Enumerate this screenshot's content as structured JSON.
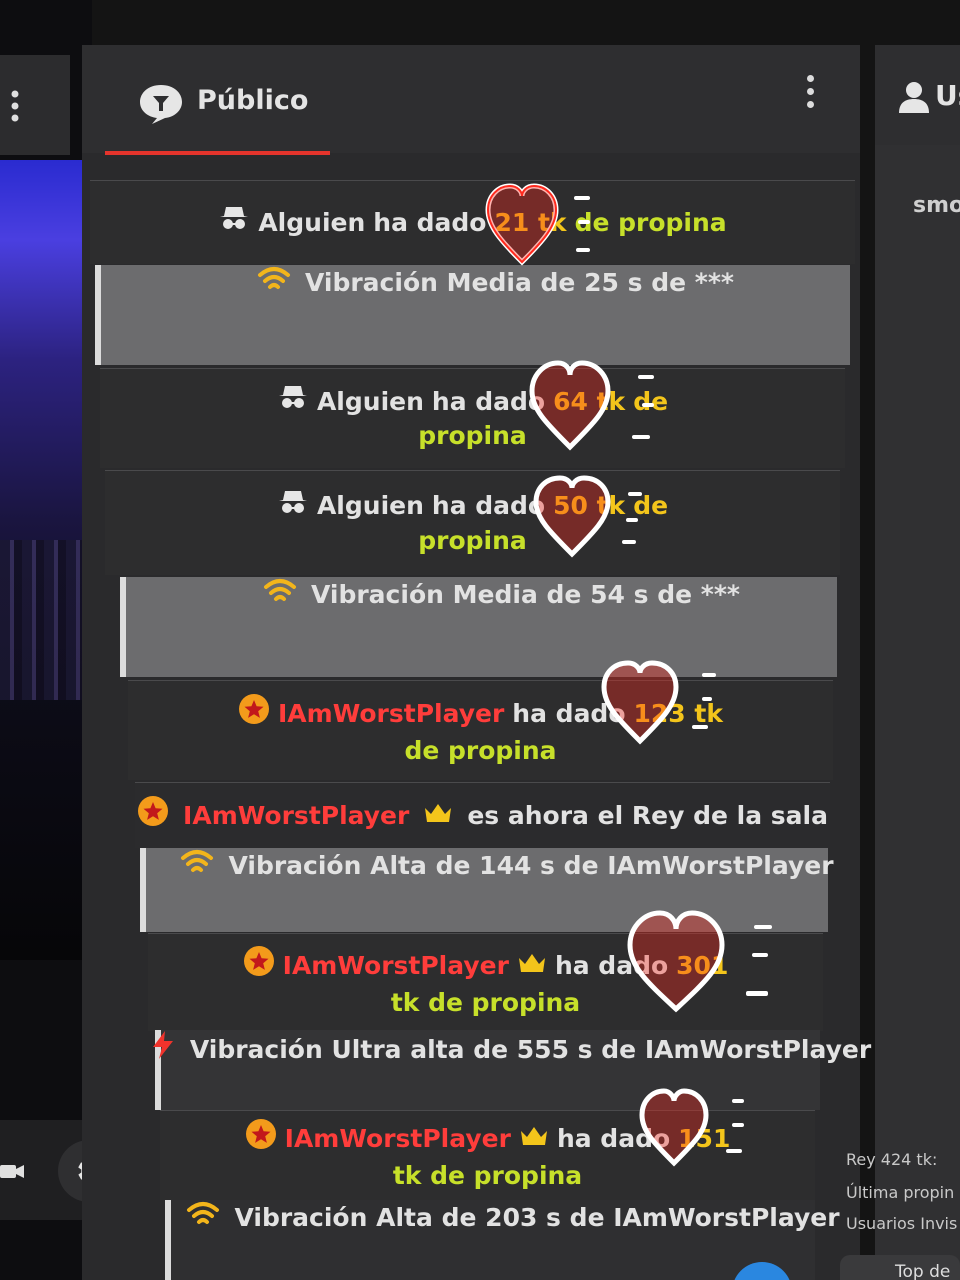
{
  "chat": {
    "title": "Público",
    "messages": [
      {
        "type": "tip",
        "user": "Alguien",
        "action": "ha dado",
        "amount": "21 tk",
        "suffix": "de propina"
      },
      {
        "type": "vibration",
        "text_a": "Vibración",
        "level": "Media",
        "text_b": "de",
        "duration": "25 s",
        "text_c": "de",
        "user": "***"
      },
      {
        "type": "tip",
        "user": "Alguien",
        "action": "ha dado",
        "amount": "64 tk",
        "suffix_a": "de",
        "suffix_b": "propina"
      },
      {
        "type": "tip",
        "user": "Alguien",
        "action": "ha dado",
        "amount": "50 tk",
        "suffix_a": "de",
        "suffix_b": "propina"
      },
      {
        "type": "vibration",
        "text_a": "Vibración",
        "level": "Media",
        "text_b": "de",
        "duration": "54 s",
        "text_c": "de",
        "user": "***"
      },
      {
        "type": "tip",
        "user": "IAmWorstPlayer",
        "action": "ha dado",
        "amount": "123 tk",
        "suffix": "de propina"
      },
      {
        "type": "king",
        "user": "IAmWorstPlayer",
        "text": "es ahora el Rey de la sala"
      },
      {
        "type": "vibration",
        "text_a": "Vibración",
        "level": "Alta",
        "text_b": "de",
        "duration": "144 s",
        "text_c": "de",
        "user": "IAmWorstPlayer"
      },
      {
        "type": "tip",
        "user": "IAmWorstPlayer",
        "action": "ha dado",
        "amount": "301",
        "suffix": "tk de propina"
      },
      {
        "type": "vibration",
        "text_a": "Vibración",
        "level": "Ultra alta",
        "text_b": "de",
        "duration": "555 s",
        "text_c": "de",
        "user": "IAmWorstPlayer"
      },
      {
        "type": "tip",
        "user": "IAmWorstPlayer",
        "action": "ha dado",
        "amount": "151",
        "suffix": "tk de propina"
      },
      {
        "type": "vibration",
        "text_a": "Vibración",
        "level": "Alta",
        "text_b": "de",
        "duration": "203 s",
        "text_c": "de",
        "user": "IAmWorstPlayer"
      }
    ]
  },
  "right_panel": {
    "header": "Us",
    "user_fragment": "smo",
    "king_label": "Rey 424 tk:",
    "last_tip_label": "Última propin",
    "invisible_users_label": "Usuarios Invis",
    "bottom_tab": "Top de"
  },
  "icons": {
    "anon_user": "hat-glasses-icon",
    "vibration_medium": "wifi-arcs-icon",
    "vibration_high": "wifi-arcs-icon",
    "vibration_ultra": "lightning-bolt-icon",
    "member": "star-badge-icon",
    "king": "crown-icon",
    "overlay": "heart-icon"
  },
  "colors": {
    "tip_amount": "#f3c51b",
    "tip_suffix": "#c7e02a",
    "username": "#ff3d3b",
    "accent_underline": "#e5342c",
    "vibration_icon": "#f3b51b",
    "heart": "#ff2a1e"
  }
}
